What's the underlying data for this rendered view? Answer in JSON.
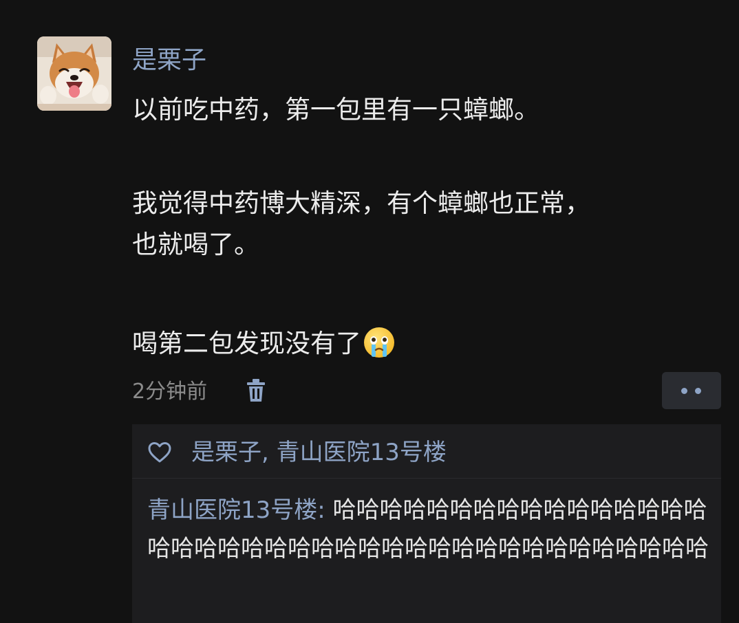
{
  "post": {
    "author": "是栗子",
    "lines": [
      "以前吃中药，第一包里有一只蟑螂。",
      "我觉得中药博大精深，有个蟑螂也正常，",
      "也就喝了。",
      "喝第二包发现没有了"
    ],
    "emoji": "crying-face-emoji",
    "timestamp": "2分钟前",
    "icons": {
      "delete": "trash-icon",
      "more": "more-dots-icon",
      "like": "heart-icon"
    }
  },
  "likes": {
    "users": "是栗子, 青山医院13号楼"
  },
  "comment": {
    "author": "青山医院13号楼",
    "separator": ": ",
    "text": "哈哈哈哈哈哈哈哈哈哈哈哈哈哈哈哈哈哈哈哈哈哈哈哈哈哈哈哈哈哈哈哈哈哈哈哈哈哈哈哈"
  },
  "colors": {
    "background": "#121212",
    "accent": "#8ea4c6",
    "body_text": "#ececec",
    "muted_text": "#8b8b8b",
    "panel": "#1d1d1f"
  }
}
